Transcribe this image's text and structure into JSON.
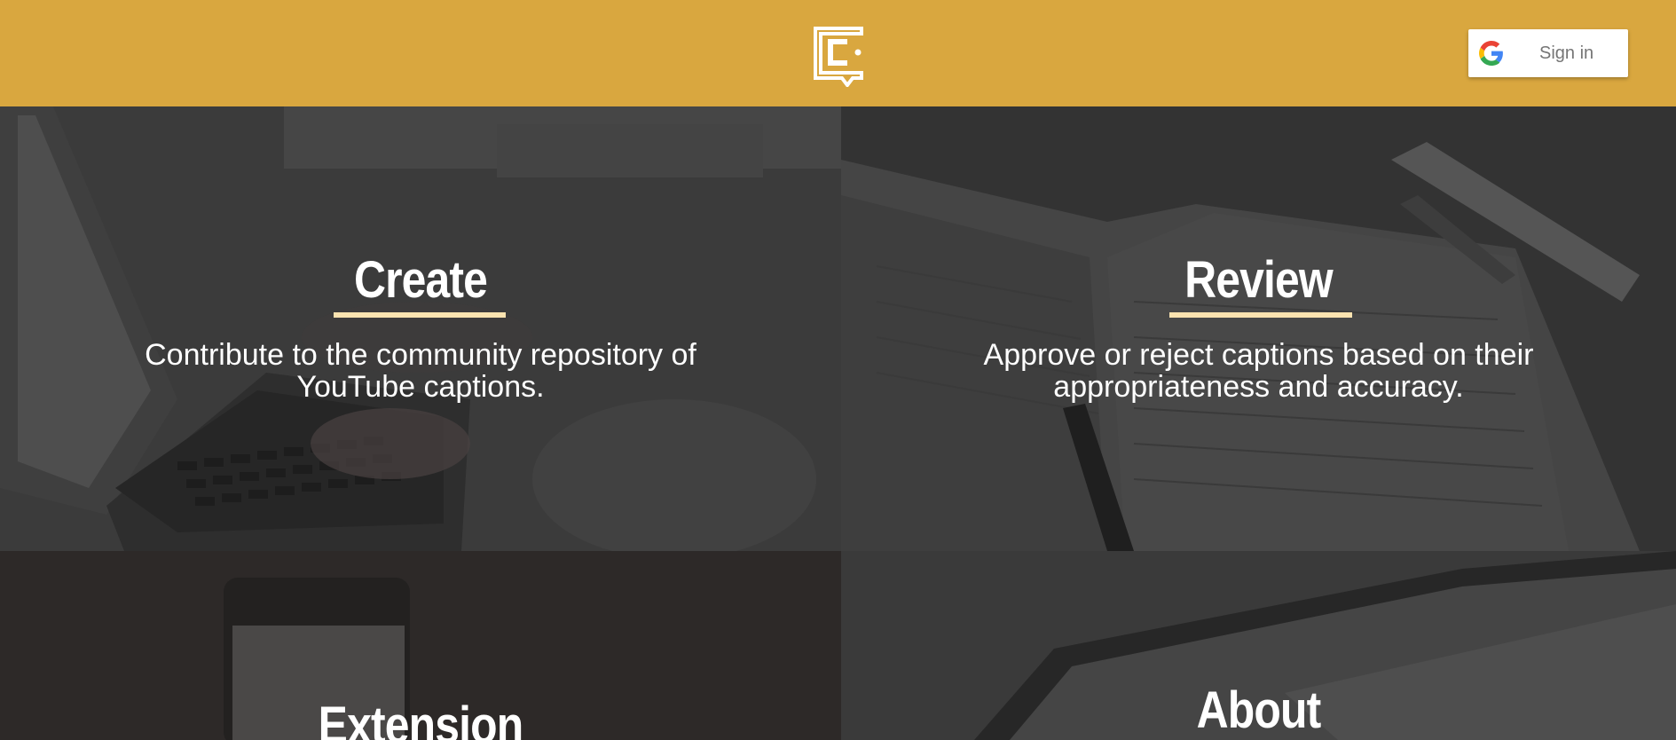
{
  "header": {
    "background": "#d9a73f",
    "logo_icon": "caption-bubble-logo-icon",
    "signin": {
      "label": "Sign in",
      "icon": "google-g-icon"
    }
  },
  "tiles": [
    {
      "title": "Create",
      "description_line1": "Contribute to the community repository of",
      "description_line2": "YouTube captions."
    },
    {
      "title": "Review",
      "description_line1": "Approve or reject captions based on their",
      "description_line2": "appropriateness and accuracy."
    },
    {
      "title": "Extension"
    },
    {
      "title": "About"
    }
  ],
  "colors": {
    "accent": "#d9a73f",
    "underline": "#fbe3b0"
  }
}
